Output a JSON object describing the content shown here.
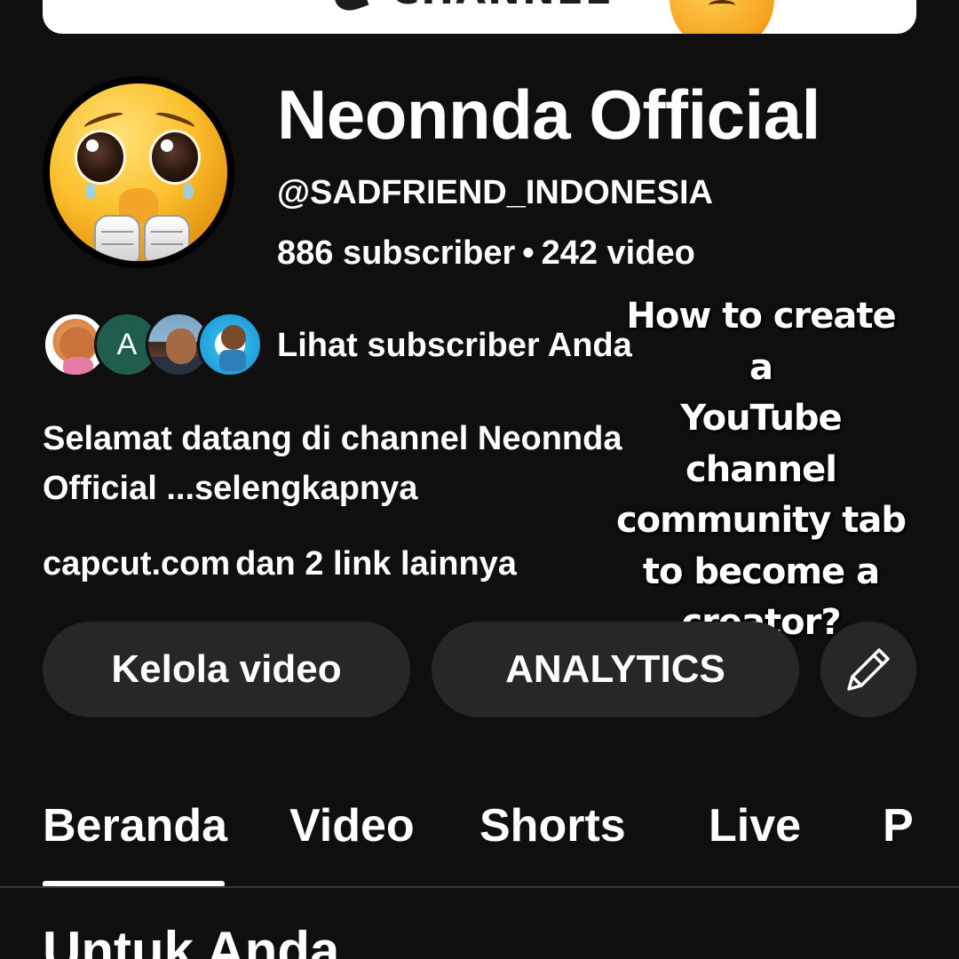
{
  "banner": {
    "text": "CHANNEL"
  },
  "channel": {
    "name": "Neonnda Official",
    "handle": "@SADFRIEND_INDONESIA",
    "subscribers": "886 subscriber",
    "separator": "•",
    "videos": "242 video"
  },
  "subscribers_row": {
    "avatar_letter": "A",
    "label": "Lihat subscriber Anda"
  },
  "overlay": {
    "lines": [
      "How to create a",
      "YouTube",
      "channel",
      "community tab",
      "to become a",
      "creator?"
    ]
  },
  "description": {
    "text": "Selamat datang di channel Neonnda Official ...selengkapnya"
  },
  "links": {
    "primary": "capcut.com",
    "more": "dan 2 link lainnya"
  },
  "actions": {
    "manage_label": "Kelola video",
    "analytics_label": "ANALYTICS",
    "edit_icon": "pencil-icon"
  },
  "tabs": [
    {
      "label": "Beranda",
      "active": true
    },
    {
      "label": "Video"
    },
    {
      "label": "Shorts"
    },
    {
      "label": "Live"
    },
    {
      "label": "P"
    }
  ],
  "section": {
    "title": "Untuk Anda"
  },
  "colors": {
    "background": "#0f0f0f",
    "button": "#272727",
    "text": "#ffffff"
  }
}
